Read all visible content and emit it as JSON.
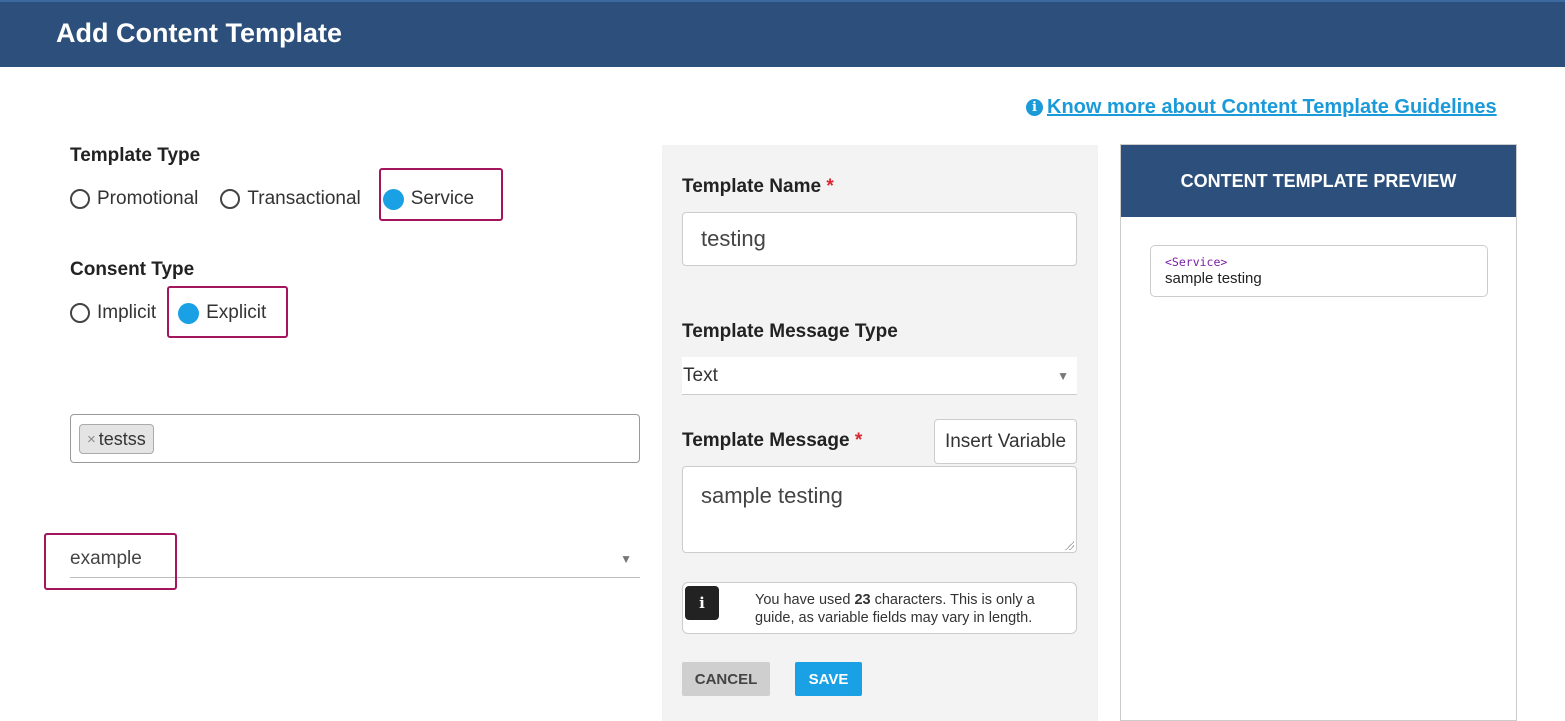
{
  "header": {
    "title": "Add Content Template"
  },
  "guide_link": {
    "icon": "info-icon",
    "label": " Know more about Content Template Guidelines"
  },
  "template_type": {
    "label": "Template Type",
    "options": [
      "Promotional",
      "Transactional",
      "Service"
    ],
    "selected": "Service"
  },
  "consent_type": {
    "label": "Consent Type",
    "options": [
      "Implicit",
      "Explicit"
    ],
    "selected": "Explicit"
  },
  "tags": {
    "remove_symbol": "×",
    "items": [
      "testss"
    ]
  },
  "example_select": {
    "value": "example"
  },
  "form": {
    "name_label": "Template Name",
    "name_value": "testing",
    "message_type_label": "Template Message Type",
    "message_type_value": "Text",
    "message_label": "Template Message",
    "required_marker": "*",
    "insert_variable_label": "Insert Variable",
    "message_value": "sample testing",
    "char_note": {
      "icon_glyph": "i",
      "prefix": "You have used ",
      "count": "23",
      "line1_suffix": " characters. This is only a",
      "line2": "guide, as variable fields may vary in length."
    },
    "cancel_label": "CANCEL",
    "save_label": "SAVE"
  },
  "preview": {
    "title": "CONTENT TEMPLATE PREVIEW",
    "tag": "<Service>",
    "message": "sample testing"
  },
  "colors": {
    "header_bg": "#2c4f7c",
    "accent": "#1aa0e4",
    "link": "#1a9ad9",
    "highlight": "#a3165e",
    "required": "#d9262f"
  }
}
